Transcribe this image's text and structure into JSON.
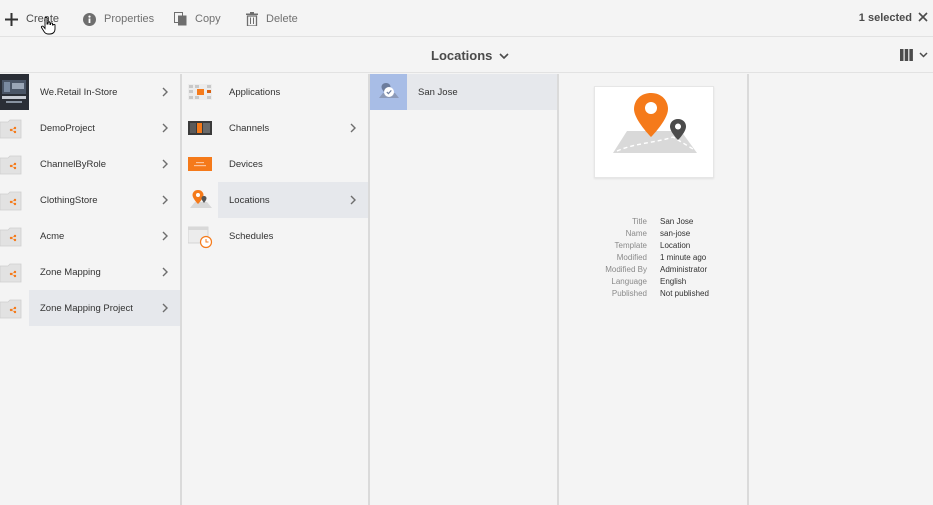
{
  "toolbar": {
    "create": "Create",
    "properties": "Properties",
    "copy": "Copy",
    "delete": "Delete",
    "selected": "1 selected"
  },
  "titlebar": {
    "title": "Locations"
  },
  "columns": {
    "projects": [
      {
        "label": "We.Retail In-Store",
        "icon": "photo-thumbnail"
      },
      {
        "label": "DemoProject",
        "icon": "folder-share-icon"
      },
      {
        "label": "ChannelByRole",
        "icon": "folder-share-icon"
      },
      {
        "label": "ClothingStore",
        "icon": "folder-share-icon"
      },
      {
        "label": "Acme",
        "icon": "folder-share-icon"
      },
      {
        "label": "Zone Mapping",
        "icon": "folder-share-icon"
      },
      {
        "label": "Zone Mapping Project",
        "icon": "folder-share-icon",
        "selected": true
      }
    ],
    "sections": [
      {
        "label": "Applications",
        "icon": "applications-icon"
      },
      {
        "label": "Channels",
        "icon": "channels-icon"
      },
      {
        "label": "Devices",
        "icon": "devices-icon"
      },
      {
        "label": "Locations",
        "icon": "location-pin-icon",
        "selected": true
      },
      {
        "label": "Schedules",
        "icon": "schedule-icon"
      }
    ],
    "locations": [
      {
        "label": "San Jose",
        "icon": "location-check-icon",
        "selected": true
      }
    ]
  },
  "preview": {
    "meta": [
      {
        "key": "Title",
        "value": "San Jose"
      },
      {
        "key": "Name",
        "value": "san-jose"
      },
      {
        "key": "Template",
        "value": "Location"
      },
      {
        "key": "Modified",
        "value": "1 minute ago"
      },
      {
        "key": "Modified By",
        "value": "Administrator"
      },
      {
        "key": "Language",
        "value": "English"
      },
      {
        "key": "Published",
        "value": "Not published"
      }
    ]
  },
  "colors": {
    "accent_orange": "#f57a1a",
    "selection_bg": "#e6e8ec",
    "selected_thumb": "#a8bde6"
  }
}
